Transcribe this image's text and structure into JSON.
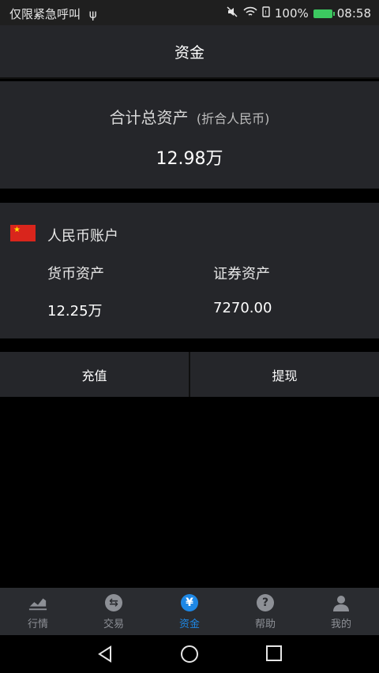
{
  "status_bar": {
    "carrier_text": "仅限紧急呼叫",
    "battery_percent": "100%",
    "time": "08:58"
  },
  "header": {
    "title": "资金"
  },
  "total_assets": {
    "label": "合计总资产",
    "sub_label": "(折合人民币)",
    "value": "12.98万"
  },
  "account": {
    "name": "人民币账户",
    "currency_label": "货币资产",
    "currency_value": "12.25万",
    "securities_label": "证券资产",
    "securities_value": "7270.00"
  },
  "actions": {
    "deposit": "充值",
    "withdraw": "提现"
  },
  "tabs": [
    {
      "label": "行情",
      "icon": "chart-icon"
    },
    {
      "label": "交易",
      "icon": "exchange-icon"
    },
    {
      "label": "资金",
      "icon": "yuan-icon",
      "active": true
    },
    {
      "label": "帮助",
      "icon": "help-icon"
    },
    {
      "label": "我的",
      "icon": "user-icon"
    }
  ],
  "colors": {
    "panel": "#25262a",
    "accent": "#1e88e5",
    "flag_red": "#d9251c"
  }
}
